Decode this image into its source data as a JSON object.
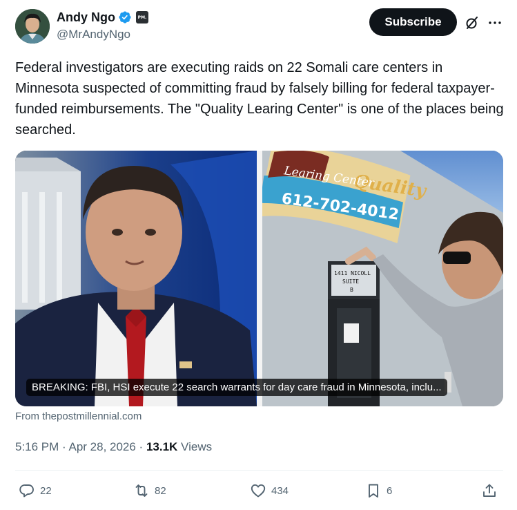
{
  "author": {
    "display_name": "Andy Ngo",
    "handle": "@MrAndyNgo",
    "affiliation_badge": "PM."
  },
  "header": {
    "subscribe_label": "Subscribe"
  },
  "tweet": {
    "text": "Federal investigators are executing raids on 22 Somali care centers in Minnesota suspected of committing fraud by falsely billing for federal taxpayer-funded reimbursements. The \"Quality Learing Center\" is one of the places being searched."
  },
  "card": {
    "caption": "BREAKING: FBI, HSI execute 22 search warrants for day care fraud in Minnesota, inclu...",
    "source": "From thepostmillennial.com",
    "sign_line1": "Quality",
    "sign_line2": "Learing Center",
    "sign_phone": "612-702-4012",
    "door_line1": "1411 NICOLL",
    "door_line2": "SUITE",
    "door_line3": "B"
  },
  "meta": {
    "time": "5:16 PM · Apr 28, 2026 · ",
    "views_count": "13.1K",
    "views_label": " Views"
  },
  "actions": {
    "replies": "22",
    "reposts": "82",
    "likes": "434",
    "bookmarks": "6"
  },
  "colors": {
    "text_primary": "#0f1419",
    "text_secondary": "#536471",
    "verified_blue": "#1d9bf0",
    "subscribe_bg": "#0f1419"
  }
}
